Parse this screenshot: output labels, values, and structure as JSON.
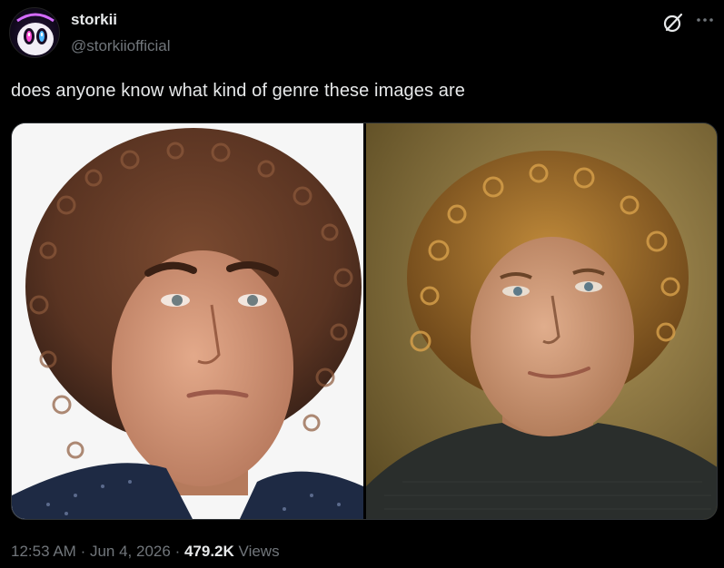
{
  "author": {
    "display_name": "storkii",
    "handle": "@storkiiofficial"
  },
  "tweet": {
    "text": "does anyone know what kind of genre these images are"
  },
  "media": {
    "count": 2
  },
  "meta": {
    "time": "12:53 AM",
    "separator": "·",
    "date": "Jun 4, 2026",
    "views_count": "479.2K",
    "views_label": "Views"
  },
  "icons": {
    "grok": "grok-icon",
    "more": "more-icon"
  },
  "colors": {
    "background": "#000000",
    "text_primary": "#e7e9ea",
    "text_secondary": "#71767b",
    "border": "#2f3336"
  }
}
